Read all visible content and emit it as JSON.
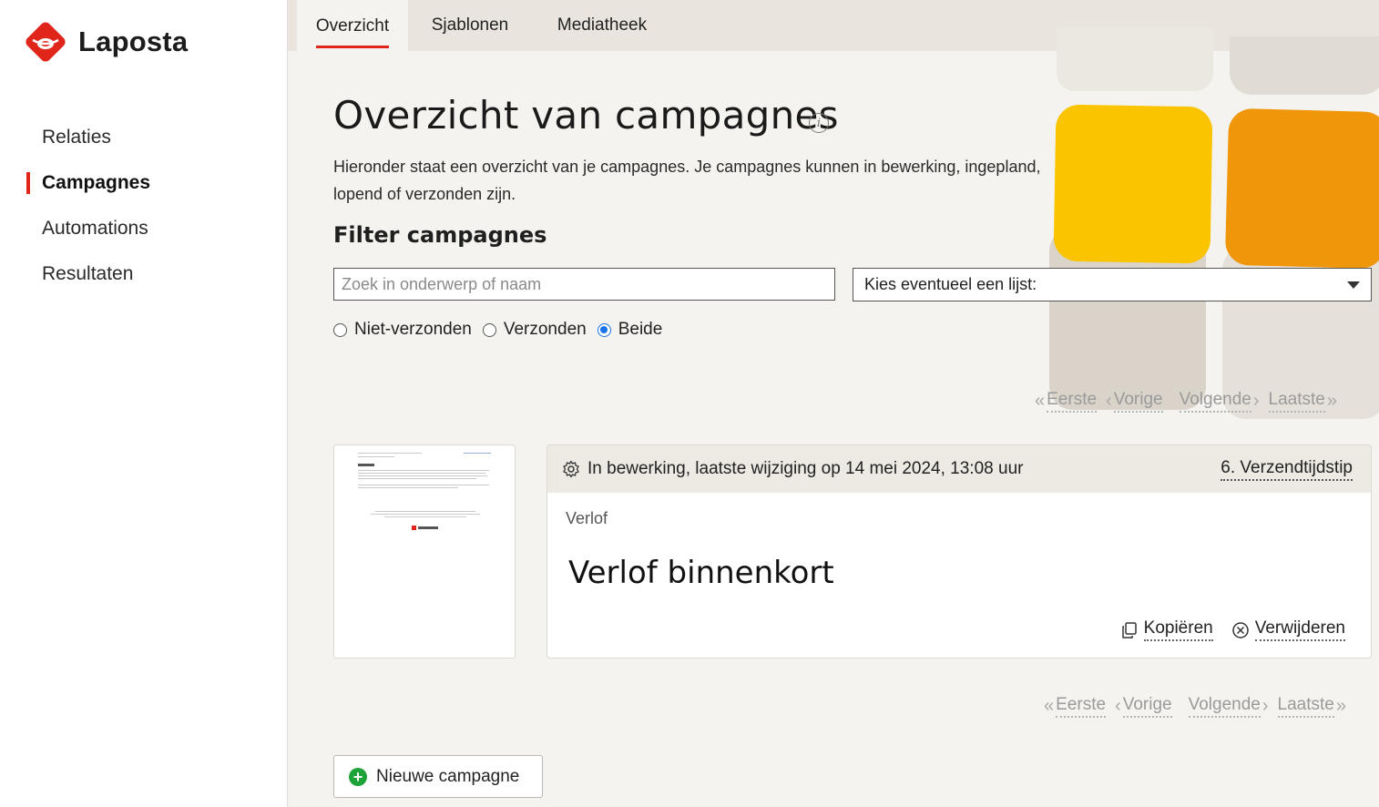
{
  "brand": {
    "name": "Laposta",
    "accent": "#e0261b"
  },
  "sidebar": {
    "items": [
      {
        "label": "Relaties",
        "active": false
      },
      {
        "label": "Campagnes",
        "active": true
      },
      {
        "label": "Automations",
        "active": false
      },
      {
        "label": "Resultaten",
        "active": false
      }
    ]
  },
  "tabs": [
    {
      "label": "Overzicht",
      "active": true
    },
    {
      "label": "Sjablonen",
      "active": false
    },
    {
      "label": "Mediatheek",
      "active": false
    }
  ],
  "main": {
    "title": "Overzicht van campagnes",
    "intro": "Hieronder staat een overzicht van je campagnes. Je campagnes kunnen in bewerking, ingepland, lopend of verzonden zijn.",
    "filter_title": "Filter campagnes",
    "search_placeholder": "Zoek in onderwerp of naam",
    "list_select": "Kies eventueel een lijst:",
    "radios": [
      {
        "label": "Niet-verzonden",
        "checked": false
      },
      {
        "label": "Verzonden",
        "checked": false
      },
      {
        "label": "Beide",
        "checked": true
      }
    ]
  },
  "pager": {
    "first": "Eerste",
    "prev": "Vorige",
    "next": "Volgende",
    "last": "Laatste"
  },
  "campaign": {
    "status": "In bewerking, laatste wijziging op 14 mei 2024, 13:08 uur",
    "step_link": "6. Verzendtijdstip",
    "name": "Verlof",
    "subject": "Verlof binnenkort",
    "copy_label": "Kopiëren",
    "delete_label": "Verwijderen"
  },
  "new_campaign_label": "Nieuwe campagne"
}
